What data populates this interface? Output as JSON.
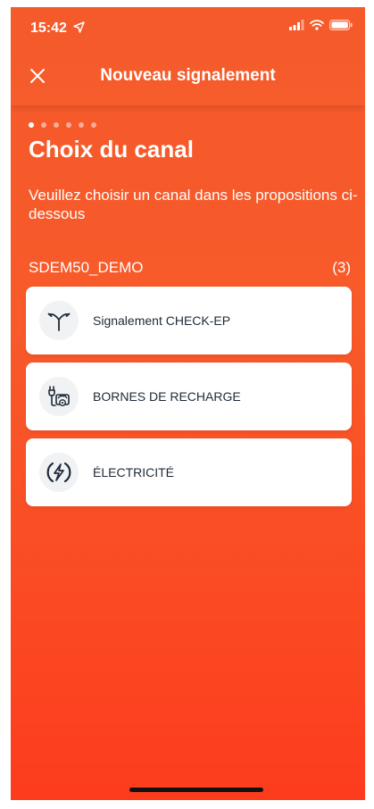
{
  "status_bar": {
    "time": "15:42"
  },
  "navbar": {
    "title": "Nouveau signalement"
  },
  "stepper": {
    "total_steps": 6,
    "current_step": 1
  },
  "heading": "Choix du canal",
  "subtitle": "Veuillez choisir un canal dans les propositions ci-dessous",
  "group": {
    "name": "SDEM50_DEMO",
    "count": "(3)",
    "channels": [
      {
        "label": "Signalement CHECK-EP",
        "icon": "street-lamp-icon"
      },
      {
        "label": "BORNES DE RECHARGE",
        "icon": "ev-charger-icon"
      },
      {
        "label": "ÉLECTRICITÉ",
        "icon": "lightning-icon"
      }
    ]
  },
  "colors": {
    "background": "#f85a2a",
    "card": "#ffffff",
    "card_text": "#1e2a38"
  }
}
